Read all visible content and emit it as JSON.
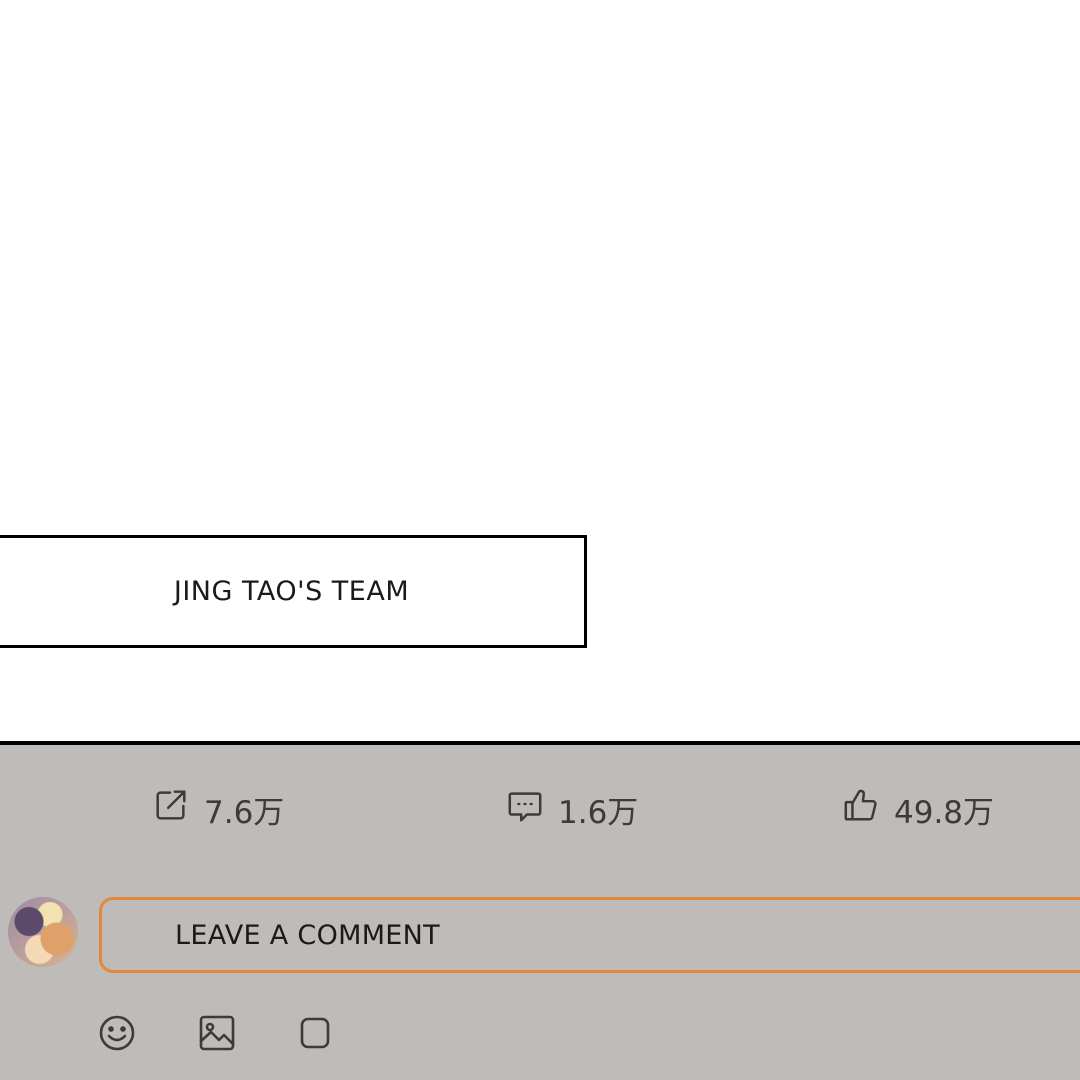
{
  "content": {
    "caption": "JING TAO'S TEAM"
  },
  "stats": {
    "share": {
      "icon": "share-icon",
      "count": "7.6万"
    },
    "comments": {
      "icon": "comment-icon",
      "count": "1.6万"
    },
    "likes": {
      "icon": "thumbs-up-icon",
      "count": "49.8万"
    }
  },
  "comment_bar": {
    "placeholder": "LEAVE A COMMENT",
    "border_color": "#e08a3c"
  },
  "toolbar": {
    "icons": [
      "emoji-icon",
      "image-icon",
      "square-icon"
    ]
  },
  "colors": {
    "panel_bg": "#bfbbb8",
    "text": "#3b3b3b"
  }
}
